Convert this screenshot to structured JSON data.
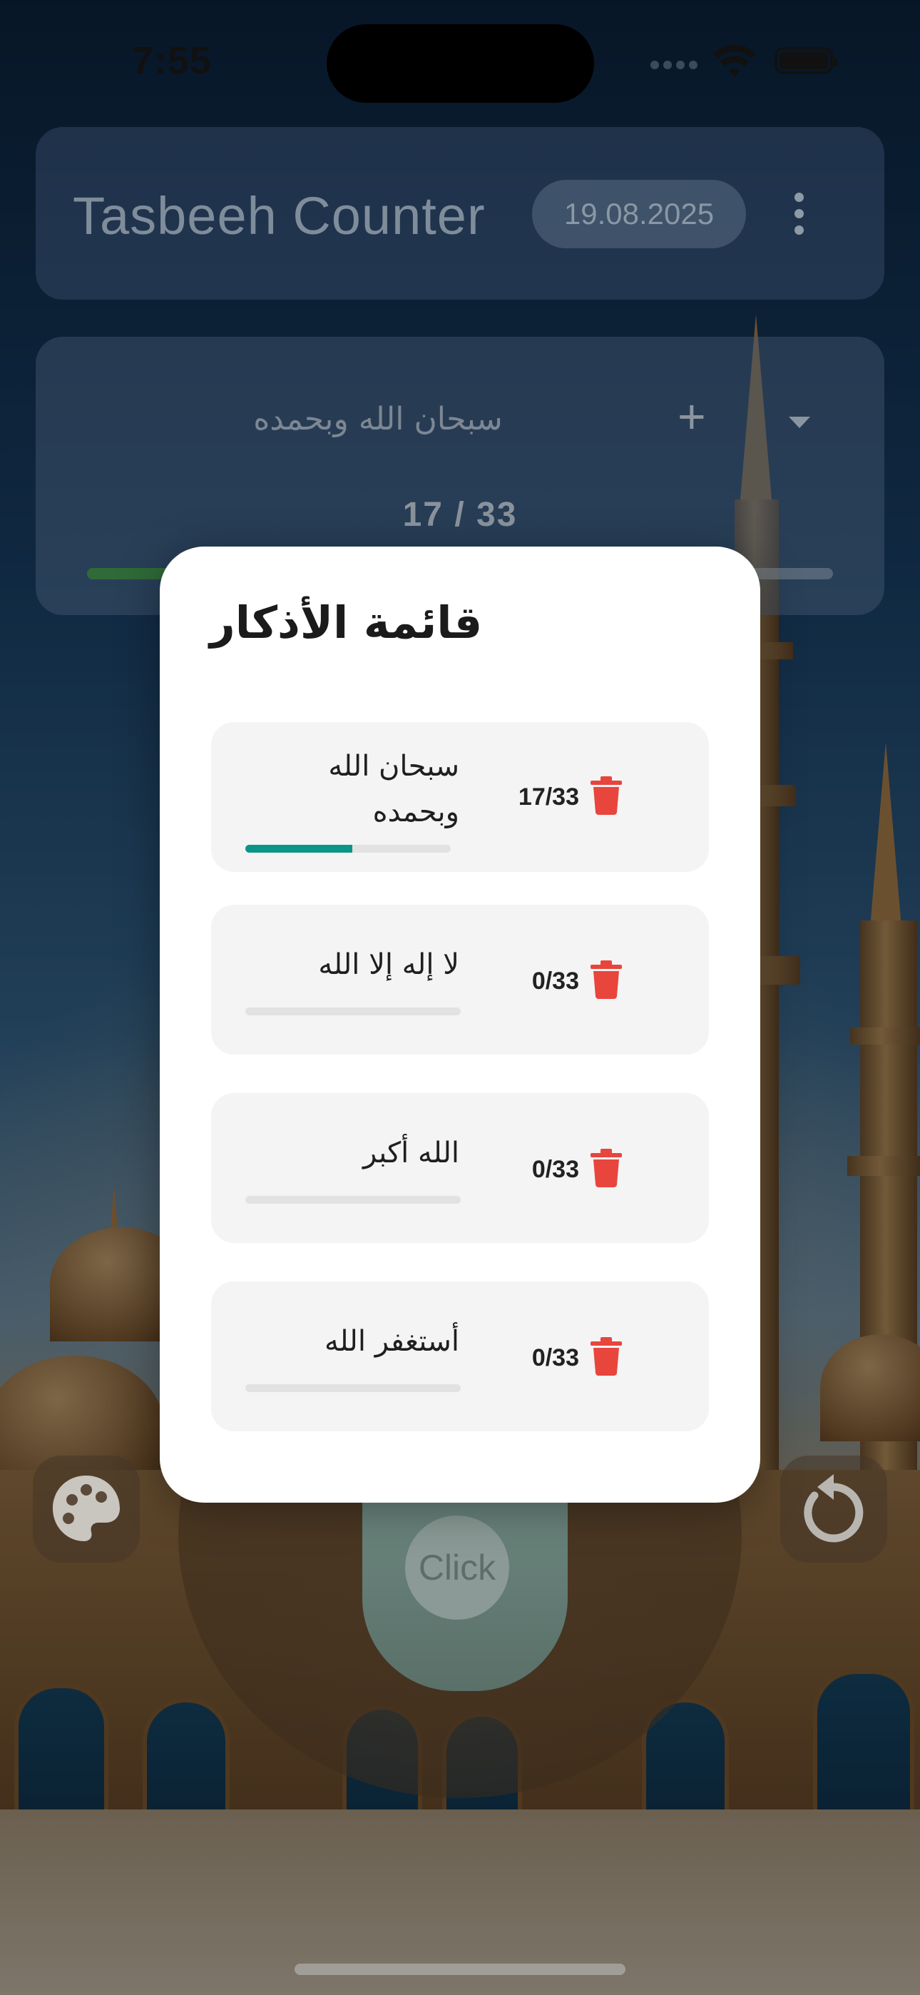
{
  "status_bar": {
    "time": "7:55"
  },
  "header": {
    "title": "Tasbeeh Counter",
    "date": "19.08.2025"
  },
  "counter": {
    "name": "سبحان الله وبحمده",
    "count_text": "17 / 33",
    "progress": 0.52
  },
  "controls": {
    "click_label": "Click"
  },
  "dialog": {
    "title": "قائمة الأذكار",
    "items": [
      {
        "line1": "سبحان الله",
        "line2": "وبحمده",
        "count": "17/33",
        "progress": 0.52
      },
      {
        "line1": "لا إله إلا الله",
        "count": "0/33",
        "progress": 0
      },
      {
        "line1": "الله أكبر",
        "count": "0/33",
        "progress": 0
      },
      {
        "line1": "أستغفر الله",
        "count": "0/33",
        "progress": 0
      }
    ]
  },
  "colors": {
    "progress_fill": "#0b9488",
    "delete_icon": "#e8453c",
    "dialog_bg": "#ffffff",
    "row_bg": "#f4f4f4"
  },
  "icons": {
    "menu": "more-vert-icon",
    "add": "plus-icon",
    "expand": "caret-down-icon",
    "delete": "trash-icon",
    "palette": "palette-icon",
    "reset": "reset-icon"
  }
}
